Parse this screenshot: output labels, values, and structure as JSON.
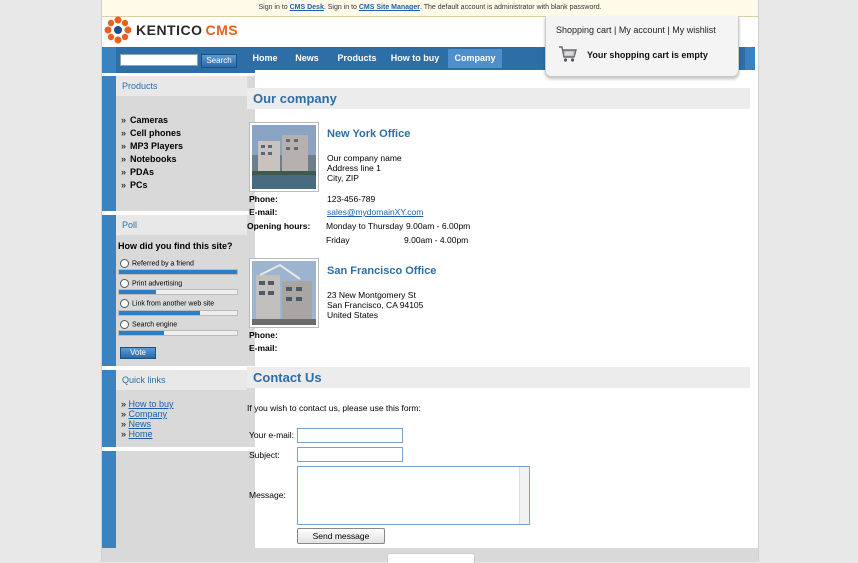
{
  "topbar": {
    "prefix": "Sign in to ",
    "desk_link": "CMS Desk",
    "middle": ". Sign in to ",
    "manager_link": "CMS Site Manager",
    "suffix": ". The default account is administrator with blank password."
  },
  "logo": {
    "name": "KENTICO",
    "product": "CMS",
    "accent": "#e8601c"
  },
  "cart": {
    "links": "Shopping cart | My account | My wishlist",
    "empty_text": "Your shopping cart is empty"
  },
  "search": {
    "placeholder": "",
    "button": "Search"
  },
  "nav": {
    "items": [
      "Home",
      "News",
      "Products",
      "How to buy",
      "Company"
    ],
    "active": "Company",
    "color": "#2e6ea6"
  },
  "products_box": {
    "title": "Products",
    "items": [
      "Cameras",
      "Cell phones",
      "MP3 Players",
      "Notebooks",
      "PDAs",
      "PCs"
    ]
  },
  "poll": {
    "title": "Poll",
    "question": "How did you find this site?",
    "options": [
      {
        "label": "Referred by a friend",
        "share": 1.0
      },
      {
        "label": "Print advertising",
        "share": 0.31
      },
      {
        "label": "Link from another web site",
        "share": 0.69
      },
      {
        "label": "Search engine",
        "share": 0.38
      }
    ],
    "vote_button": "Vote"
  },
  "quick_links": {
    "title": "Quick links",
    "items": [
      "How to buy",
      "Company",
      "News",
      "Home"
    ]
  },
  "company": {
    "title": "Our company",
    "offices": [
      {
        "name": "New York Office",
        "address": [
          "Our company name",
          "Address line 1",
          "City, ZIP"
        ],
        "phone_label": "Phone:",
        "phone": "123-456-789",
        "email_label": "E-mail:",
        "email": "sales@mydomainXY.com",
        "hours_label": "Opening hours:",
        "hours": [
          {
            "days": "Monday to Thursday",
            "time": "9.00am - 6.00pm"
          },
          {
            "days": "Friday",
            "time": "9.00am - 4.00pm"
          }
        ]
      },
      {
        "name": "San Francisco Office",
        "address": [
          "23 New Montgomery St",
          "San Francisco, CA 94105",
          "United States"
        ],
        "phone_label": "Phone:",
        "phone": "",
        "email_label": "E-mail:",
        "email": ""
      }
    ]
  },
  "contact": {
    "title": "Contact Us",
    "intro": "If you wish to contact us, please use this form:",
    "email_label": "Your e-mail:",
    "subject_label": "Subject:",
    "message_label": "Message:",
    "send_button": "Send message"
  }
}
